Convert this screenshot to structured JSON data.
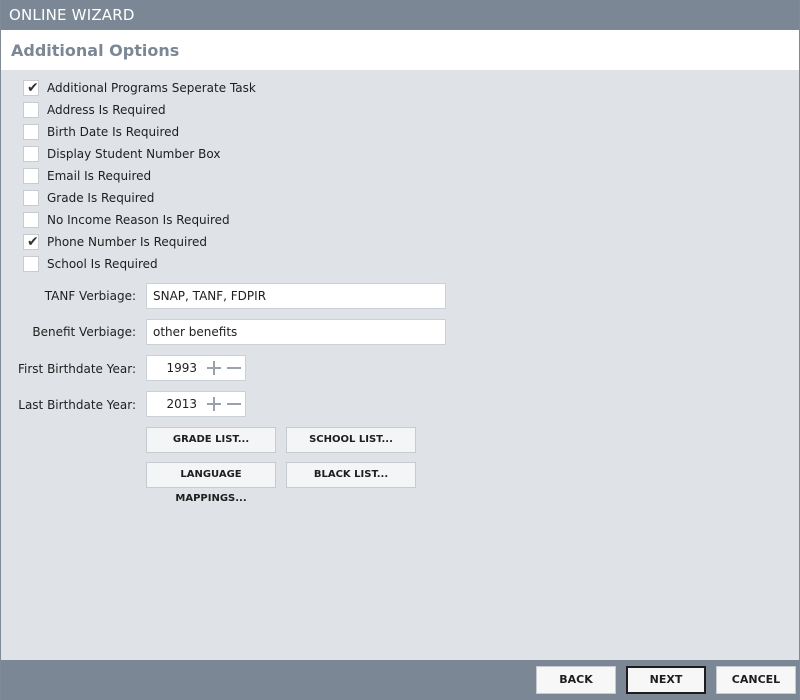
{
  "window": {
    "title": "ONLINE WIZARD"
  },
  "header": {
    "title": "Additional Options"
  },
  "options": [
    {
      "label": "Additional Programs Seperate Task",
      "checked": true
    },
    {
      "label": "Address Is Required",
      "checked": false
    },
    {
      "label": "Birth Date Is Required",
      "checked": false
    },
    {
      "label": "Display Student Number Box",
      "checked": false
    },
    {
      "label": "Email Is Required",
      "checked": false
    },
    {
      "label": "Grade Is Required",
      "checked": false
    },
    {
      "label": "No Income Reason Is Required",
      "checked": false
    },
    {
      "label": "Phone Number Is Required",
      "checked": true
    },
    {
      "label": "School Is Required",
      "checked": false
    }
  ],
  "fields": {
    "tanf": {
      "label": "TANF Verbiage:",
      "value": "SNAP, TANF, FDPIR"
    },
    "benefit": {
      "label": "Benefit Verbiage:",
      "value": "other benefits"
    },
    "first_year": {
      "label": "First Birthdate Year:",
      "value": "1993"
    },
    "last_year": {
      "label": "Last Birthdate Year:",
      "value": "2013"
    }
  },
  "buttons": {
    "grade_list": "GRADE LIST...",
    "school_list": "SCHOOL LIST...",
    "language_mappings": "LANGUAGE MAPPINGS...",
    "black_list": "BLACK LIST..."
  },
  "footer": {
    "back": "BACK",
    "next": "NEXT",
    "cancel": "CANCEL"
  }
}
